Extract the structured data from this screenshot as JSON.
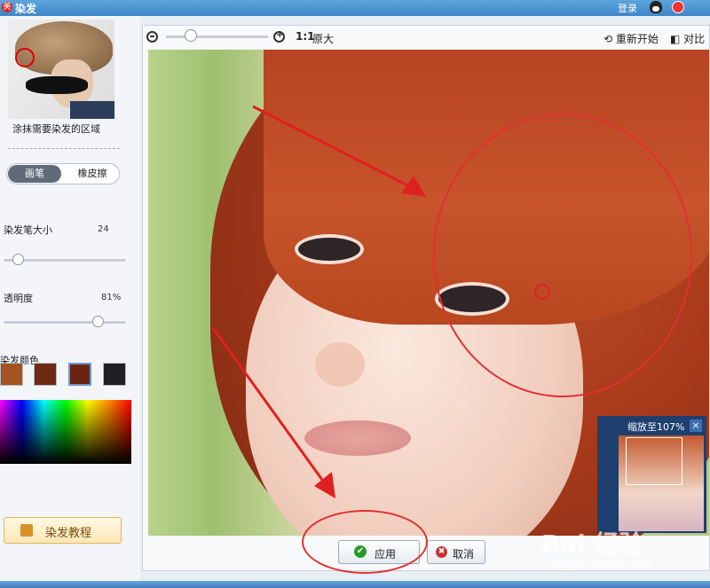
{
  "window": {
    "title": "染发",
    "login_label": "登录"
  },
  "sidebar": {
    "caption": "涂抹需要染发的区域",
    "tool_brush": "画笔",
    "tool_eraser": "橡皮擦",
    "brush_size_label": "染发笔大小",
    "brush_size_value": "24",
    "opacity_label": "透明度",
    "opacity_value": "81%",
    "color_label": "染发颜色",
    "swatches": [
      "#a3531f",
      "#6f2b12",
      "#6b2411",
      "#1e2025"
    ],
    "tutorial_label": "染发教程"
  },
  "toolbar": {
    "ratio_label": "1:1",
    "original_label": "原大",
    "reset_label": "重新开始",
    "compare_label": "对比"
  },
  "preview": {
    "zoom_label": "缩放至107%",
    "close_icon": "×"
  },
  "actions": {
    "apply_label": "应用",
    "cancel_label": "取消"
  },
  "watermark": {
    "brand": "Bai 经验",
    "url": "jingyan.baidu.com"
  }
}
